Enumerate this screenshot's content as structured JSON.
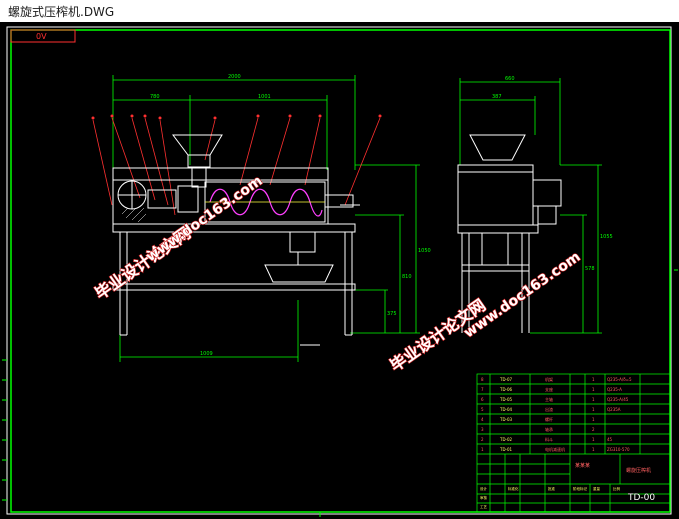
{
  "window": {
    "title": "螺旋式压榨机.DWG"
  },
  "drawing": {
    "corner_tag": "0V",
    "dims_front": {
      "overall": "2000",
      "left": "780",
      "mid": "1001",
      "bottom": "1009",
      "h1": "1050",
      "h2": "810",
      "h3": "375"
    },
    "dims_side": {
      "overall": "660",
      "top": "387",
      "h1": "1055",
      "h2": "578"
    },
    "watermark": {
      "text1": "毕业设计论文网",
      "text2": "www.doc163.com"
    },
    "title_block": {
      "name_cell": "螺旋压榨机",
      "drawing_no": "TD-00",
      "company": "某某某",
      "rows": [
        {
          "no": "8",
          "code": "TD-07",
          "name": "机架",
          "qty": "1",
          "mat": "Q235-A/δ=5"
        },
        {
          "no": "7",
          "code": "TD-06",
          "name": "支座",
          "qty": "1",
          "mat": "Q235-A"
        },
        {
          "no": "6",
          "code": "TD-05",
          "name": "主轴",
          "qty": "1",
          "mat": "Q235-A/45"
        },
        {
          "no": "5",
          "code": "TD-04",
          "name": "出渣",
          "qty": "1",
          "mat": "Q235A"
        },
        {
          "no": "4",
          "code": "TD-03",
          "name": "螺杆",
          "qty": "1",
          "mat": ""
        },
        {
          "no": "3",
          "code": "",
          "name": "轴承",
          "qty": "2",
          "mat": ""
        },
        {
          "no": "2",
          "code": "TD-02",
          "name": "料斗",
          "qty": "1",
          "mat": "45"
        },
        {
          "no": "1",
          "code": "",
          "name": "电机减速机",
          "qty": "1",
          "mat": ""
        },
        {
          "no": "",
          "code": "TD-01",
          "name": "底座",
          "qty": "1",
          "mat": "ZG310-570"
        }
      ]
    }
  }
}
